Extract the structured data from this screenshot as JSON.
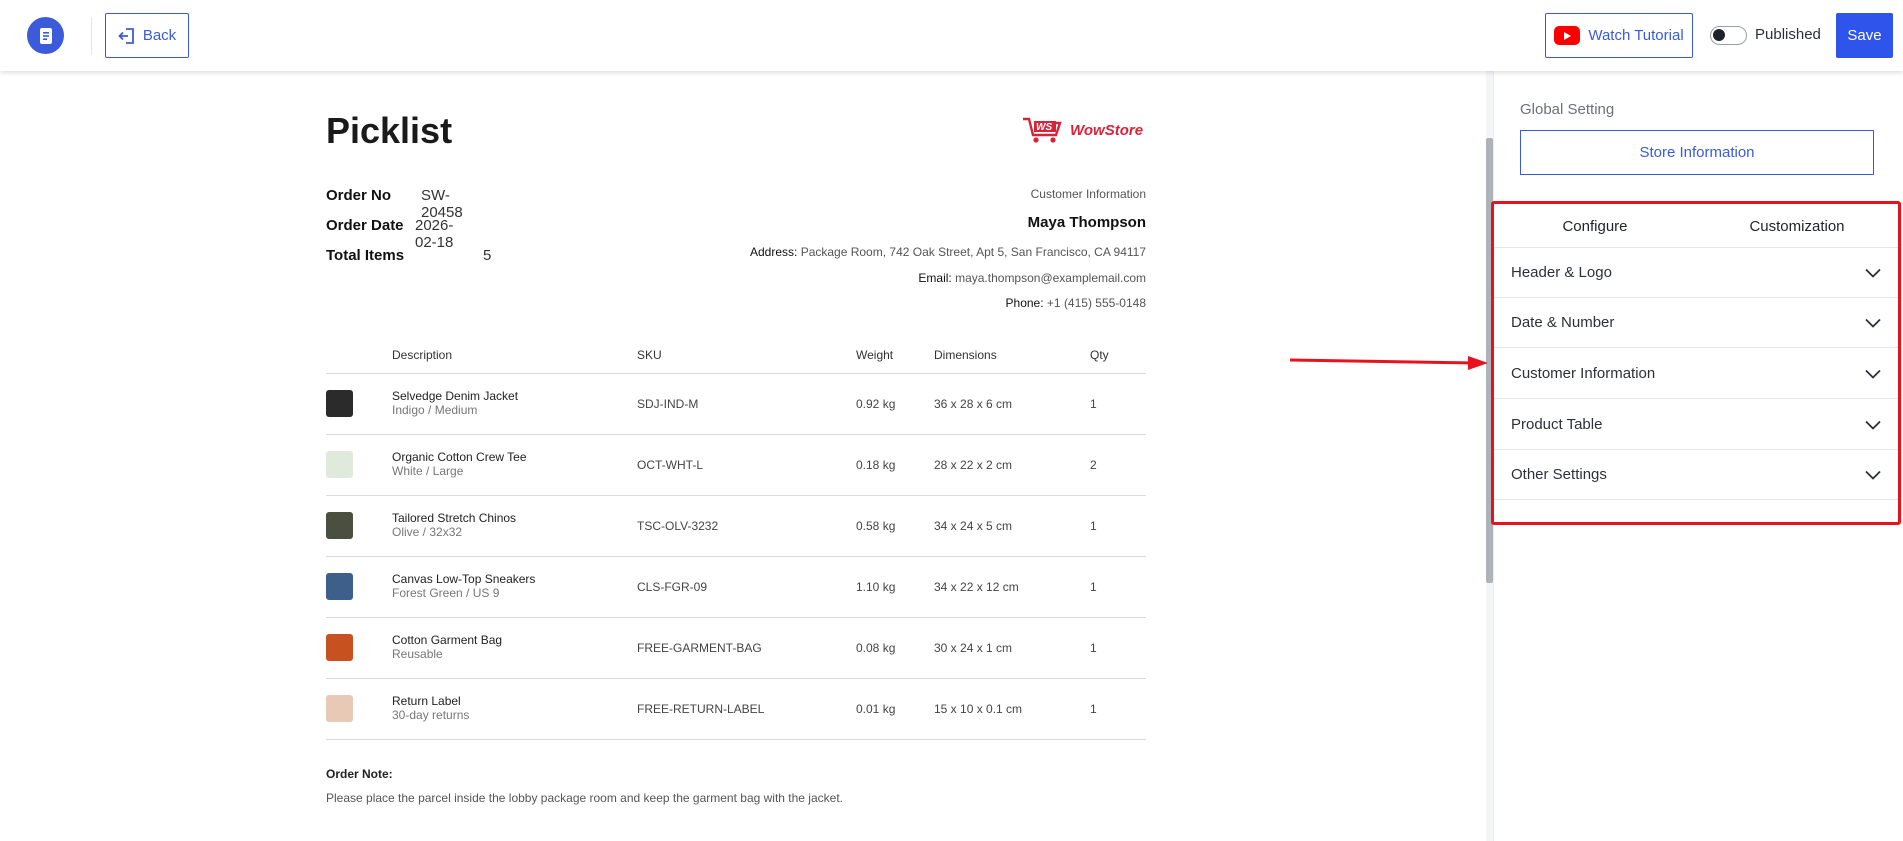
{
  "topbar": {
    "back_label": "Back",
    "watch_label": "Watch Tutorial",
    "published_label": "Published",
    "save_label": "Save"
  },
  "document": {
    "title": "Picklist",
    "logo_text": "WowStore",
    "meta": [
      {
        "label": "Order No",
        "value": "SW-20458"
      },
      {
        "label": "Order Date",
        "value": "2026-02-18"
      },
      {
        "label": "Total Items",
        "value": "5"
      }
    ],
    "customer": {
      "heading": "Customer Information",
      "name": "Maya Thompson",
      "address_label": "Address:",
      "address": "Package Room, 742 Oak Street, Apt 5, San Francisco, CA 94117",
      "email_label": "Email:",
      "email": "maya.thompson@examplemail.com",
      "phone_label": "Phone:",
      "phone": "+1 (415) 555-0148"
    },
    "table": {
      "headers": [
        "Description",
        "SKU",
        "Weight",
        "Dimensions",
        "Qty"
      ],
      "rows": [
        {
          "name": "Selvedge Denim Jacket",
          "variant": "Indigo / Medium",
          "sku": "SDJ-IND-M",
          "weight": "0.92 kg",
          "dims": "36 x 28 x 6 cm",
          "qty": "1",
          "color": "#2b2b2b"
        },
        {
          "name": "Organic Cotton Crew Tee",
          "variant": "White / Large",
          "sku": "OCT-WHT-L",
          "weight": "0.18 kg",
          "dims": "28 x 22 x 2 cm",
          "qty": "2",
          "color": "#dfeadc"
        },
        {
          "name": "Tailored Stretch Chinos",
          "variant": "Olive / 32x32",
          "sku": "TSC-OLV-3232",
          "weight": "0.58 kg",
          "dims": "34 x 24 x 5 cm",
          "qty": "1",
          "color": "#4a4f40"
        },
        {
          "name": "Canvas Low-Top Sneakers",
          "variant": "Forest Green / US 9",
          "sku": "CLS-FGR-09",
          "weight": "1.10 kg",
          "dims": "34 x 22 x 12 cm",
          "qty": "1",
          "color": "#3d5f8a"
        },
        {
          "name": "Cotton Garment Bag",
          "variant": "Reusable",
          "sku": "FREE-GARMENT-BAG",
          "weight": "0.08 kg",
          "dims": "30 x 24 x 1 cm",
          "qty": "1",
          "color": "#c7521f"
        },
        {
          "name": "Return Label",
          "variant": "30-day returns",
          "sku": "FREE-RETURN-LABEL",
          "weight": "0.01 kg",
          "dims": "15 x 10 x 0.1 cm",
          "qty": "1",
          "color": "#e7c9b5"
        }
      ]
    },
    "note_label": "Order Note:",
    "note_text": "Please place the parcel inside the lobby package room and keep the garment bag with the jacket."
  },
  "panel": {
    "global_label": "Global Setting",
    "store_button": "Store Information",
    "tabs": [
      "Configure",
      "Customization"
    ],
    "sections": [
      "Header & Logo",
      "Date & Number",
      "Customer Information",
      "Product Table",
      "Other Settings"
    ]
  },
  "colors": {
    "accent": "#2f54eb",
    "highlight": "#e8121f",
    "brand": "#d6253b"
  }
}
